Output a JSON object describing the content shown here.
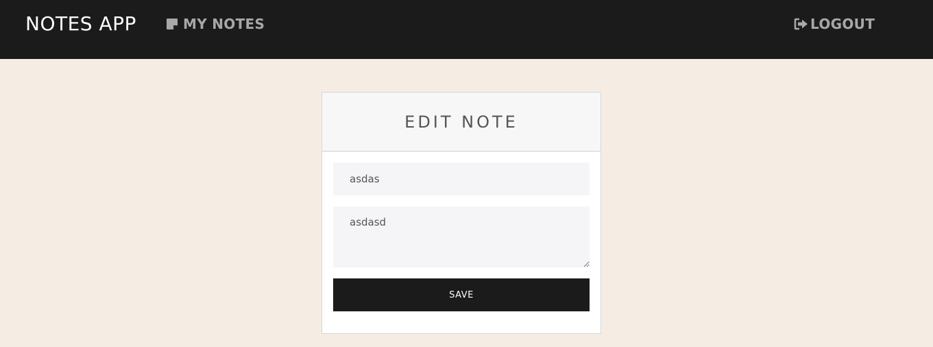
{
  "navbar": {
    "brand": "NOTES APP",
    "my_notes_label": "MY NOTES",
    "my_notes_icon": "sticky-note-icon",
    "logout_label": "LOGOUT",
    "logout_icon": "sign-out-icon"
  },
  "edit_form": {
    "title": "EDIT NOTE",
    "note_title_value": "asdas",
    "note_content_value": "asdasd",
    "save_label": "SAVE"
  },
  "colors": {
    "navbar_bg": "#1b1b1b",
    "page_bg": "#f5ede3",
    "button_bg": "#1b1b1b",
    "nav_link": "#a8a8a8"
  }
}
